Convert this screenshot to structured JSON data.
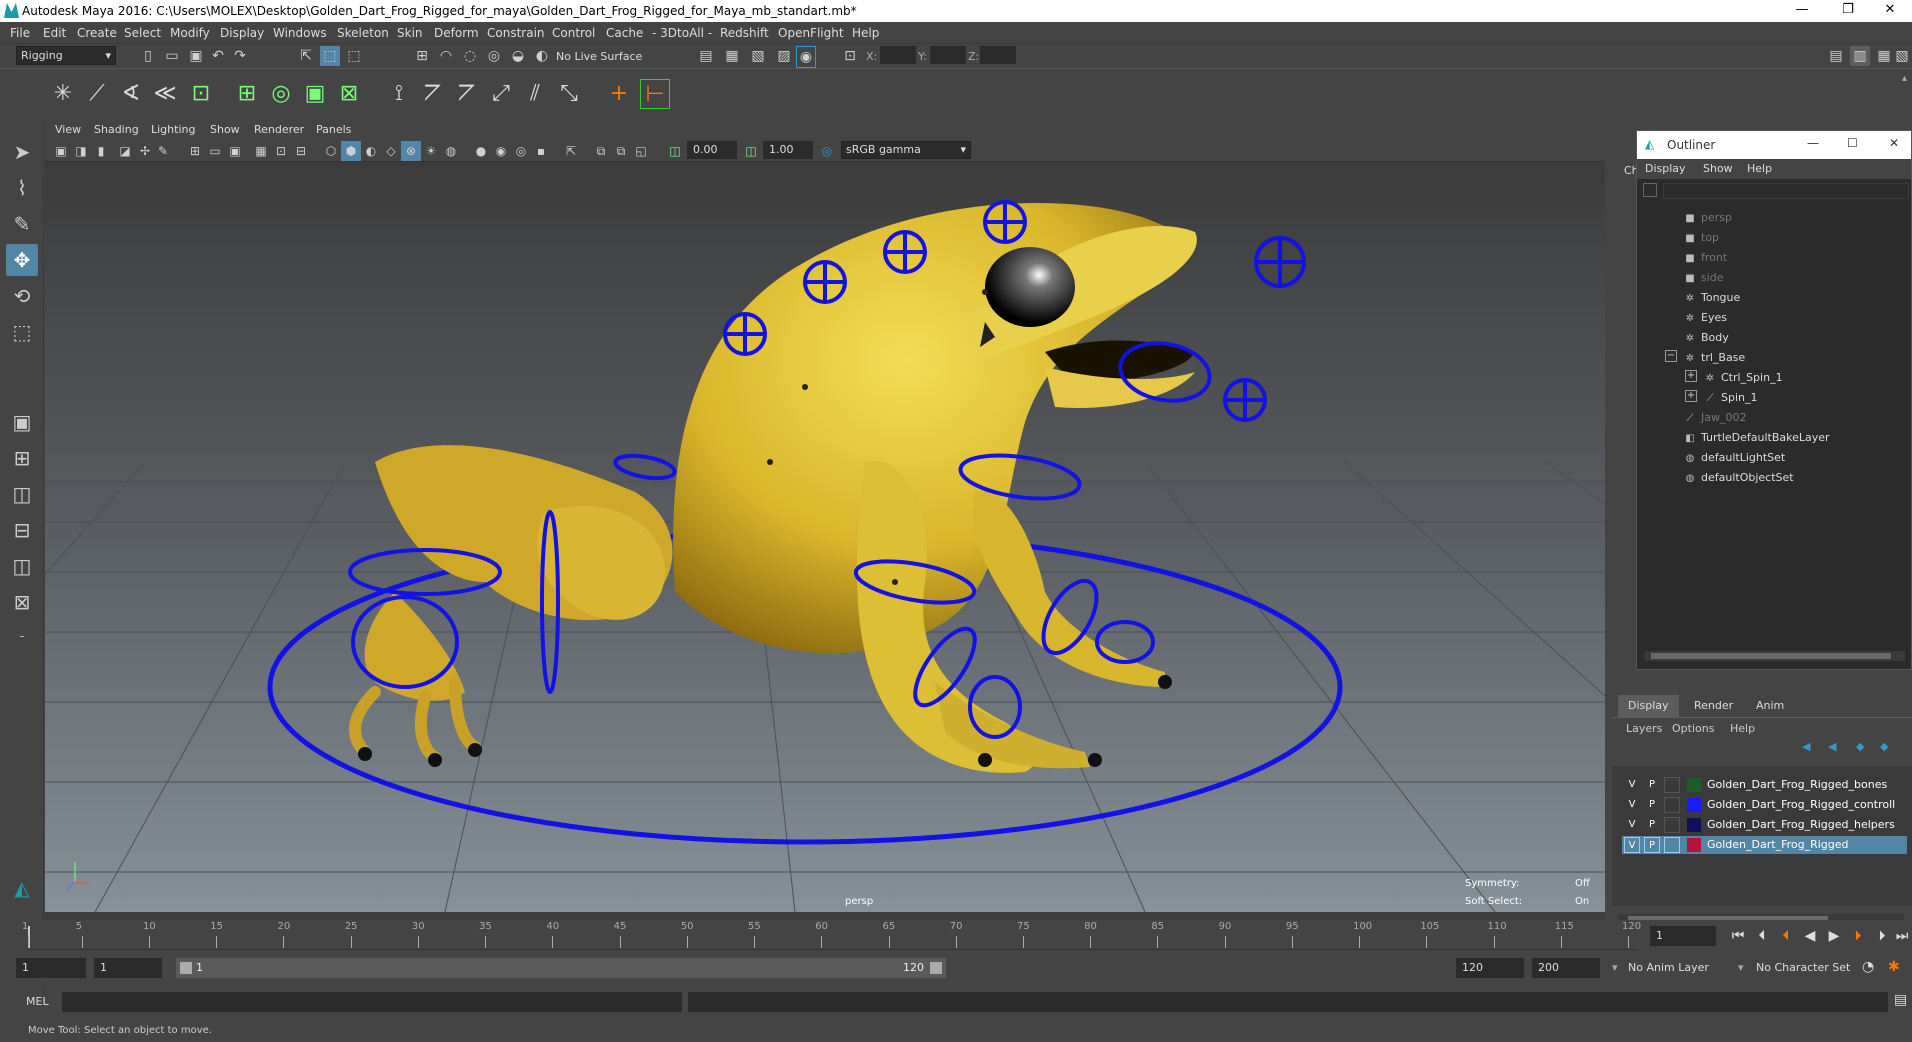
{
  "window": {
    "title": "Autodesk Maya 2016: C:\\Users\\MOLEX\\Desktop\\Golden_Dart_Frog_Rigged_for_maya\\Golden_Dart_Frog_Rigged_for_Maya_mb_standart.mb*",
    "minimize": "—",
    "maximize": "❐",
    "close": "✕"
  },
  "menubar": [
    "File",
    "Edit",
    "Create",
    "Select",
    "Modify",
    "Display",
    "Windows",
    "Skeleton",
    "Skin",
    "Deform",
    "Constrain",
    "Control",
    "Cache",
    "- 3DtoAll -",
    "Redshift",
    "OpenFlight",
    "Help"
  ],
  "status": {
    "mode": "Rigging",
    "live_surface": "No Live Surface",
    "x_label": "X:",
    "y_label": "Y:",
    "z_label": "Z:"
  },
  "viewport": {
    "menu": [
      "View",
      "Shading",
      "Lighting",
      "Show",
      "Renderer",
      "Panels"
    ],
    "exposure": "0.00",
    "gamma": "1.00",
    "colorspace": "sRGB gamma",
    "camera_label": "persp",
    "symmetry_label": "Symmetry:",
    "symmetry_value": "Off",
    "soft_select_label": "Soft Select:",
    "soft_select_value": "On"
  },
  "outliner": {
    "title": "Outliner",
    "menu": [
      "Display",
      "Show",
      "Help"
    ],
    "side_label": "Ch",
    "items": [
      {
        "label": "persp",
        "icon": "camera-icon",
        "dim": true
      },
      {
        "label": "top",
        "icon": "camera-icon",
        "dim": true
      },
      {
        "label": "front",
        "icon": "camera-icon",
        "dim": true
      },
      {
        "label": "side",
        "icon": "camera-icon",
        "dim": true
      },
      {
        "label": "Tongue",
        "icon": "transform-icon",
        "dim": false
      },
      {
        "label": "Eyes",
        "icon": "transform-icon",
        "dim": false
      },
      {
        "label": "Body",
        "icon": "transform-icon",
        "dim": false
      },
      {
        "label": "trl_Base",
        "icon": "transform-icon",
        "dim": false
      },
      {
        "label": "Ctrl_Spin_1",
        "icon": "transform-icon",
        "dim": false
      },
      {
        "label": "Spin_1",
        "icon": "joint-icon",
        "dim": false
      },
      {
        "label": "Jaw_002",
        "icon": "joint-icon",
        "dim": true
      },
      {
        "label": "TurtleDefaultBakeLayer",
        "icon": "layer-icon",
        "dim": false
      },
      {
        "label": "defaultLightSet",
        "icon": "set-icon",
        "dim": false
      },
      {
        "label": "defaultObjectSet",
        "icon": "set-icon",
        "dim": false
      }
    ]
  },
  "layers": {
    "tabs": [
      "Display",
      "Render",
      "Anim"
    ],
    "menu": [
      "Layers",
      "Options",
      "Help"
    ],
    "rows": [
      {
        "v": "V",
        "p": "P",
        "color": "#1f5a2a",
        "name": "Golden_Dart_Frog_Rigged_bones"
      },
      {
        "v": "V",
        "p": "P",
        "color": "#1b1bff",
        "name": "Golden_Dart_Frog_Rigged_controll"
      },
      {
        "v": "V",
        "p": "P",
        "color": "#10105a",
        "name": "Golden_Dart_Frog_Rigged_helpers"
      },
      {
        "v": "V",
        "p": "P",
        "color": "#b3123c",
        "name": "Golden_Dart_Frog_Rigged"
      }
    ]
  },
  "timeline": {
    "ticks": [
      "1",
      "5",
      "10",
      "15",
      "20",
      "25",
      "30",
      "35",
      "40",
      "45",
      "50",
      "55",
      "60",
      "65",
      "70",
      "75",
      "80",
      "85",
      "90",
      "95",
      "100",
      "105",
      "110",
      "115",
      "120"
    ],
    "current_frame": "1"
  },
  "range": {
    "start": "1",
    "start2": "1",
    "slider_start": "1",
    "slider_end": "120",
    "end": "120",
    "max": "200",
    "anim_layer": "No Anim Layer",
    "char_set": "No Character Set"
  },
  "cmd": {
    "label": "MEL"
  },
  "help": {
    "text": "Move Tool: Select an object to move."
  }
}
